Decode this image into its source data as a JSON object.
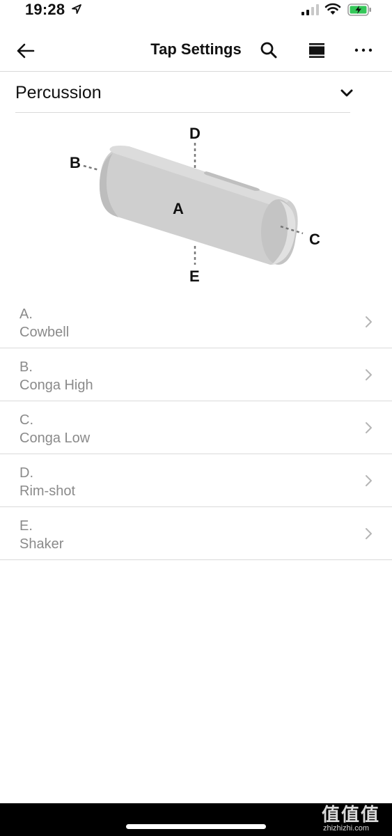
{
  "status_bar": {
    "time": "19:28"
  },
  "nav": {
    "title": "Tap Settings"
  },
  "dropdown": {
    "label": "Percussion"
  },
  "diagram": {
    "labels": {
      "a": "A",
      "b": "B",
      "c": "C",
      "d": "D",
      "e": "E"
    }
  },
  "tap_items": [
    {
      "letter": "A.",
      "name": "Cowbell"
    },
    {
      "letter": "B.",
      "name": "Conga High"
    },
    {
      "letter": "C.",
      "name": "Conga Low"
    },
    {
      "letter": "D.",
      "name": "Rim-shot"
    },
    {
      "letter": "E.",
      "name": "Shaker"
    }
  ],
  "watermark": {
    "logo": "值值值",
    "url": "zhizhizhi.com"
  },
  "colors": {
    "battery": "#34c759",
    "text_muted": "#8a8a8a",
    "divider": "#d9d9d9",
    "speaker_body": "#cfcfcf"
  }
}
